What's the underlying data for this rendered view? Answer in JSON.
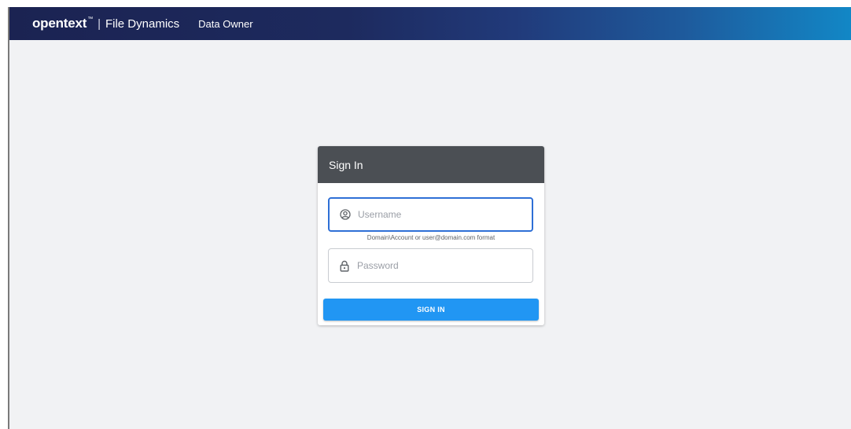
{
  "header": {
    "logo": "opentext",
    "trademark": "™",
    "separator": "|",
    "product": "File Dynamics",
    "role": "Data Owner"
  },
  "signin": {
    "title": "Sign In",
    "username": {
      "placeholder": "Username",
      "value": "",
      "icon": "user-circle-icon"
    },
    "username_hint": "Domain\\Account or user@domain.com format",
    "password": {
      "placeholder": "Password",
      "value": "",
      "icon": "lock-icon"
    },
    "submit_label": "SIGN IN"
  },
  "colors": {
    "accent": "#2196f3",
    "focus_border": "#2e6fd6",
    "card_header": "#4b4f54",
    "background": "#f1f2f4"
  }
}
